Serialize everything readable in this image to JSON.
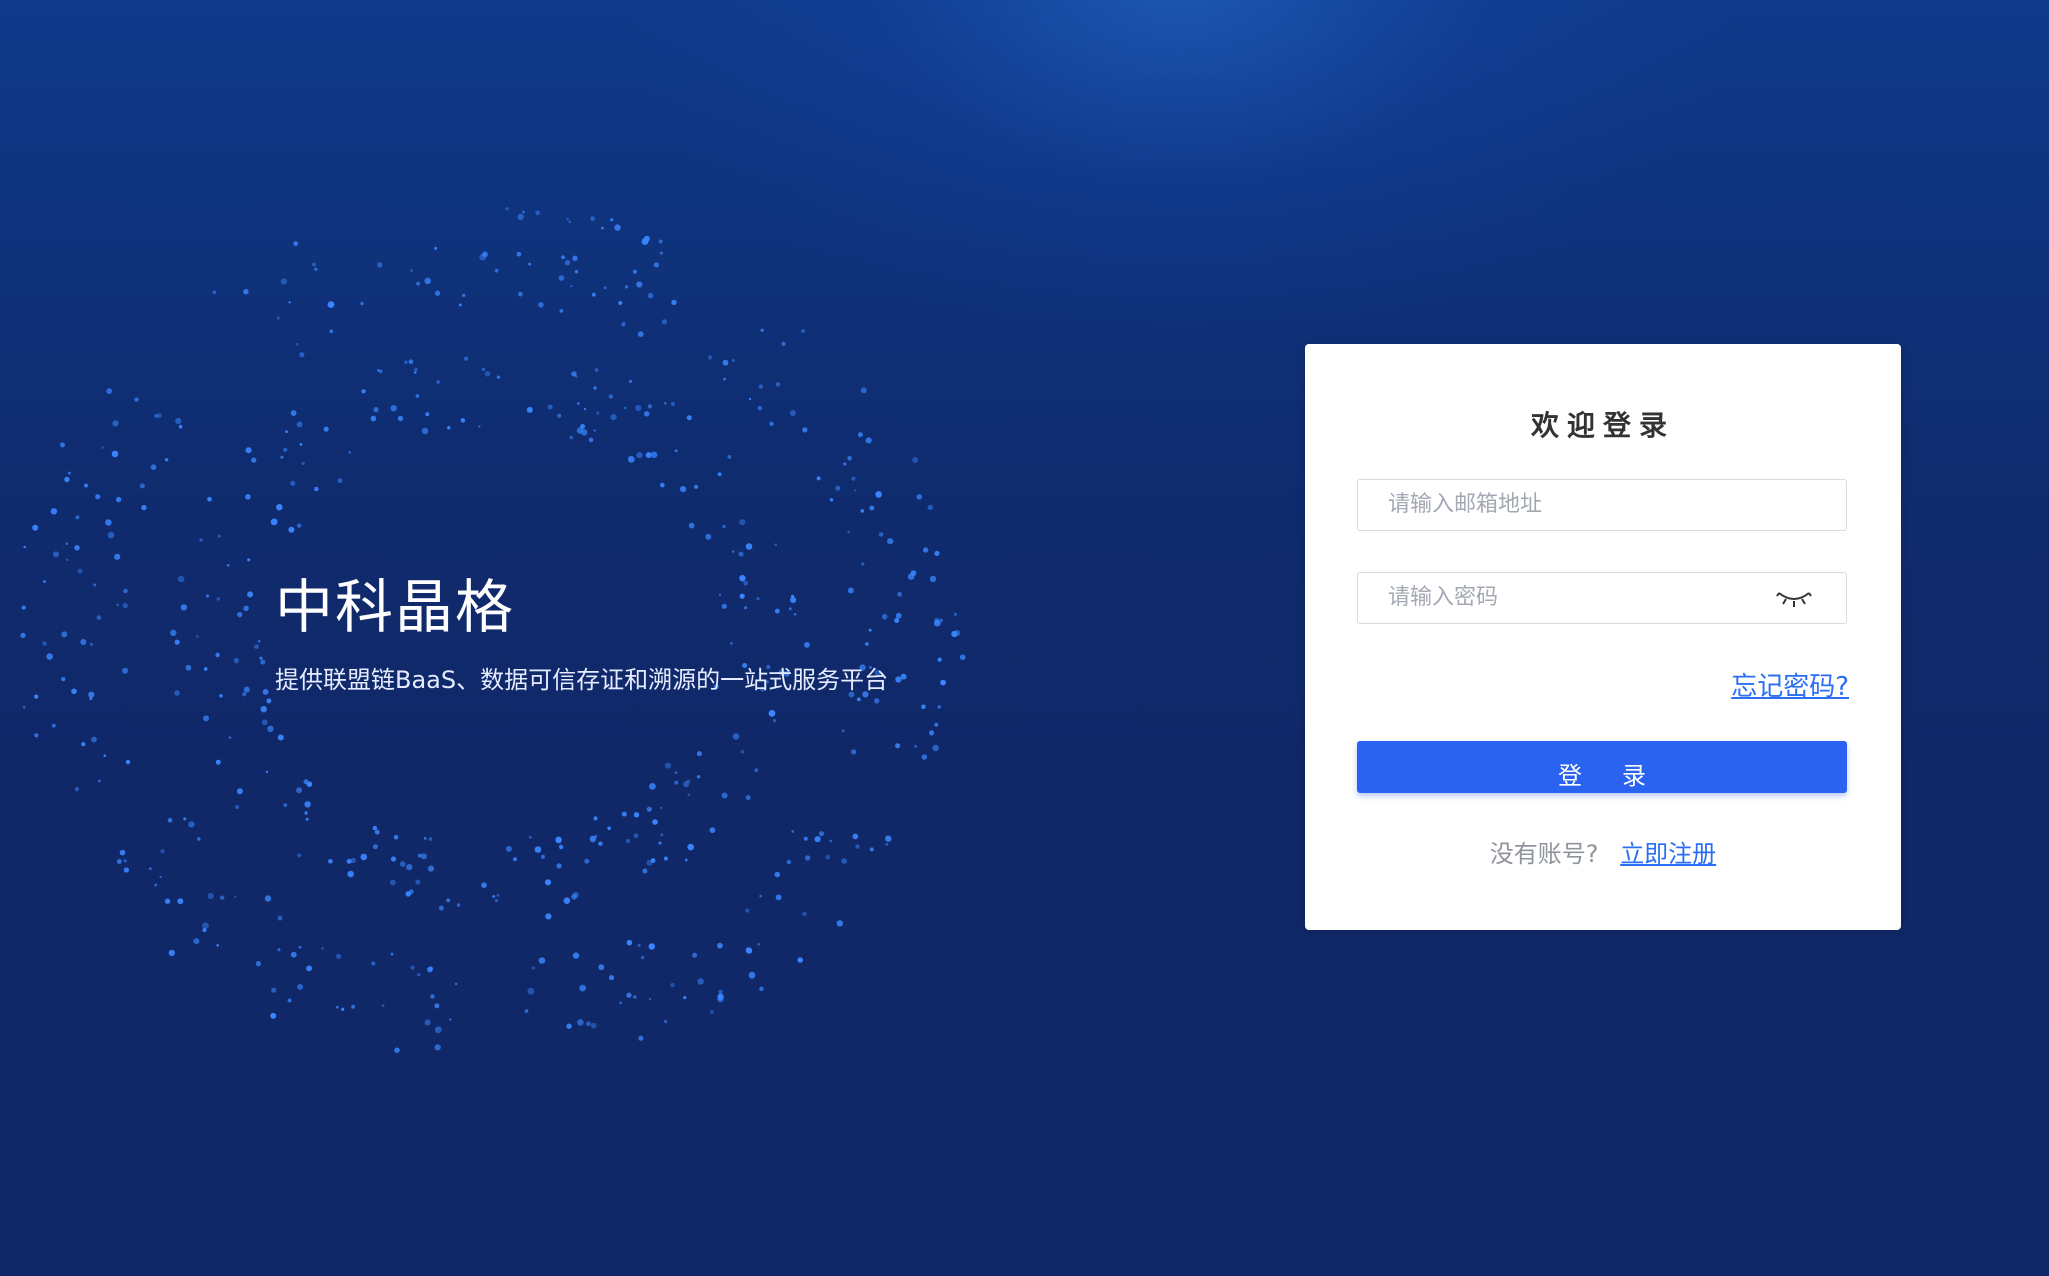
{
  "brand": {
    "title": "中科晶格",
    "subtitle": "提供联盟链BaaS、数据可信存证和溯源的一站式服务平台"
  },
  "login": {
    "title": "欢迎登录",
    "email_placeholder": "请输入邮箱地址",
    "password_placeholder": "请输入密码",
    "password_toggle_icon": "eye-closed-icon",
    "forgot_password": "忘记密码?",
    "submit_label": "登录",
    "no_account_prompt": "没有账号?",
    "register_link": "立即注册"
  },
  "colors": {
    "background": "#0f2c70",
    "accent": "#2a63f0",
    "link": "#2b6ef5",
    "dots": "#3a86ff"
  }
}
